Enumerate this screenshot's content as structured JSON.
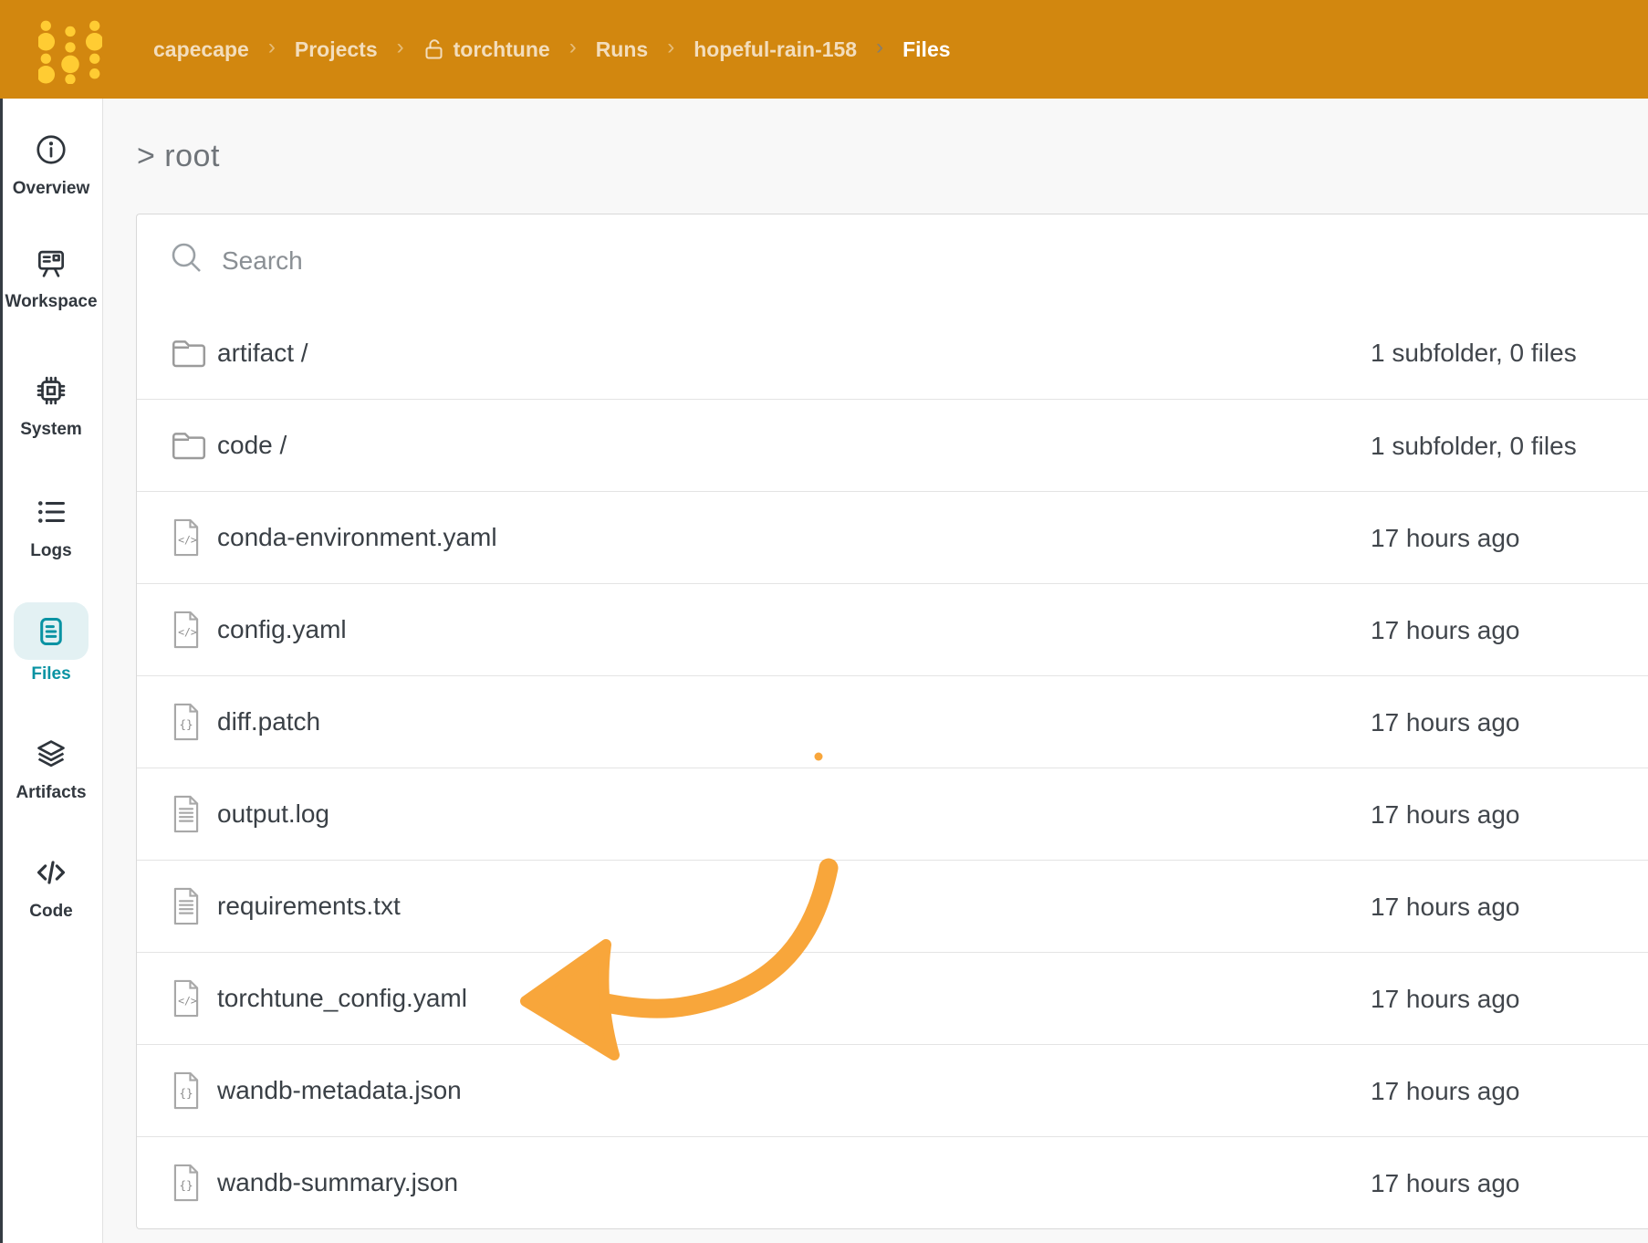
{
  "header": {
    "logo": "wandb-logo",
    "separator": "›",
    "breadcrumb": [
      {
        "label": "capecape"
      },
      {
        "label": "Projects"
      },
      {
        "label": "torchtune",
        "icon": "unlock-icon"
      },
      {
        "label": "Runs"
      },
      {
        "label": "hopeful-rain-158"
      },
      {
        "label": "Files",
        "active": true
      }
    ]
  },
  "sidebar": {
    "items": [
      {
        "label": "Overview",
        "icon": "info-icon"
      },
      {
        "label": "Workspace",
        "icon": "workspace-board-icon"
      },
      {
        "label": "System",
        "icon": "cpu-chip-icon"
      },
      {
        "label": "Logs",
        "icon": "list-icon"
      },
      {
        "label": "Files",
        "icon": "document-icon",
        "active": true
      },
      {
        "label": "Artifacts",
        "icon": "layers-icon"
      },
      {
        "label": "Code",
        "icon": "code-icon"
      }
    ]
  },
  "main": {
    "path_heading": "> root",
    "search": {
      "placeholder": "Search",
      "icon": "search-icon"
    },
    "files": [
      {
        "name": "artifact /",
        "type": "folder",
        "icon": "folder-icon",
        "meta": "1 subfolder, 0 files"
      },
      {
        "name": "code /",
        "type": "folder",
        "icon": "folder-icon",
        "meta": "1 subfolder, 0 files"
      },
      {
        "name": "conda-environment.yaml",
        "type": "code",
        "icon": "code-file-icon",
        "meta": "17 hours ago"
      },
      {
        "name": "config.yaml",
        "type": "code",
        "icon": "code-file-icon",
        "meta": "17 hours ago"
      },
      {
        "name": "diff.patch",
        "type": "braces",
        "icon": "json-file-icon",
        "meta": "17 hours ago"
      },
      {
        "name": "output.log",
        "type": "text",
        "icon": "text-file-icon",
        "meta": "17 hours ago"
      },
      {
        "name": "requirements.txt",
        "type": "text",
        "icon": "text-file-icon",
        "meta": "17 hours ago"
      },
      {
        "name": "torchtune_config.yaml",
        "type": "code",
        "icon": "code-file-icon",
        "meta": "17 hours ago",
        "annotated": true
      },
      {
        "name": "wandb-metadata.json",
        "type": "braces",
        "icon": "json-file-icon",
        "meta": "17 hours ago"
      },
      {
        "name": "wandb-summary.json",
        "type": "braces",
        "icon": "json-file-icon",
        "meta": "17 hours ago"
      }
    ]
  },
  "annotation": {
    "shape": "hand-drawn-arrow",
    "points_to": "torchtune_config.yaml"
  },
  "colors": {
    "header_bg": "#D2870F",
    "logo_yellow": "#FFCC33",
    "accent_teal": "#0993A3",
    "accent_teal_bg": "#E3F1F3",
    "annotation_orange": "#F8A63B",
    "row_text": "#3A4046",
    "muted_text": "#8A8F94"
  }
}
